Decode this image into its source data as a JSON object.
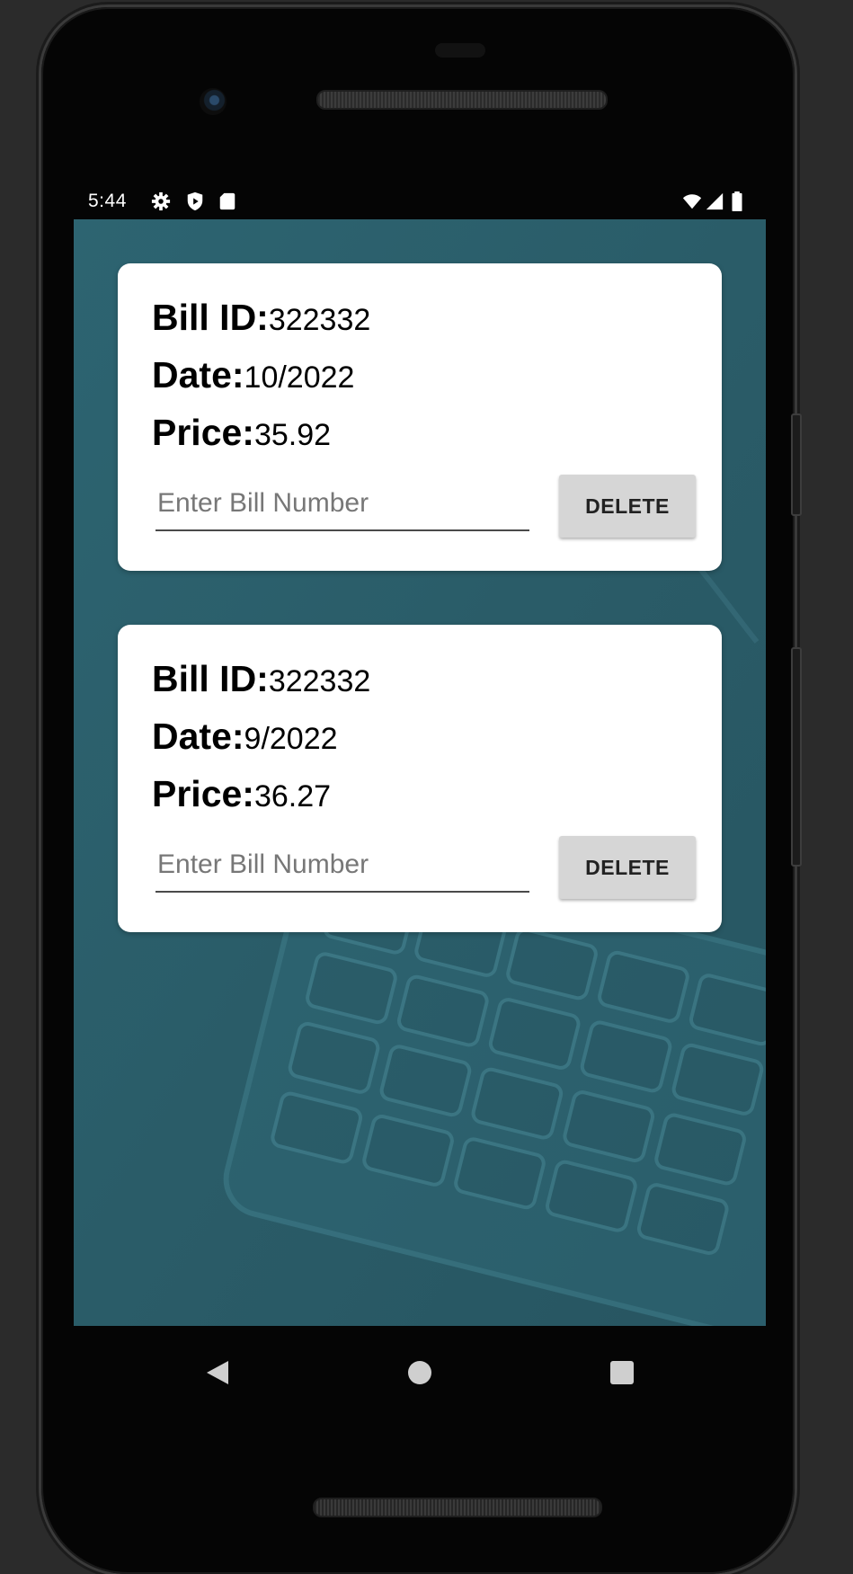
{
  "status_bar": {
    "time": "5:44",
    "left_icons": [
      "gear-icon",
      "shield-icon",
      "sd-card-icon"
    ],
    "right_icons": [
      "wifi-icon",
      "signal-icon",
      "battery-icon"
    ]
  },
  "bills": [
    {
      "id_label": "Bill ID:",
      "id_value": "322332",
      "date_label": "Date:",
      "date_value": "10/2022",
      "price_label": "Price:",
      "price_value": "35.92",
      "input_placeholder": "Enter Bill Number",
      "button_label": "DELETE"
    },
    {
      "id_label": "Bill ID:",
      "id_value": "322332",
      "date_label": "Date:",
      "date_value": "9/2022",
      "price_label": "Price:",
      "price_value": "36.27",
      "input_placeholder": "Enter Bill Number",
      "button_label": "DELETE"
    }
  ],
  "nav": [
    "back-icon",
    "home-icon",
    "recents-icon"
  ],
  "colors": {
    "screen_background": "#2b5d68",
    "card_background": "#ffffff",
    "button_background": "#d6d6d6"
  }
}
